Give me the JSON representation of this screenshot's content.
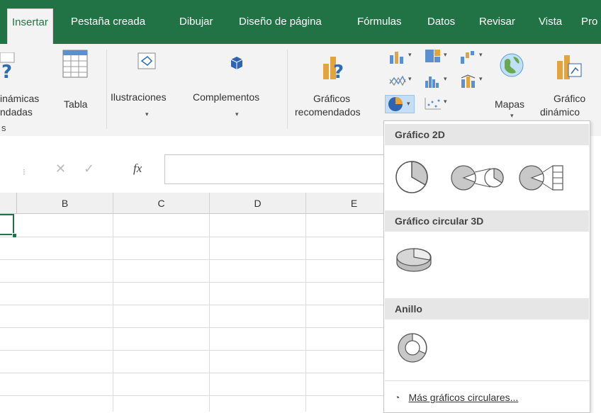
{
  "tabs": [
    {
      "label": "Insertar",
      "active": true
    },
    {
      "label": "Pestaña creada"
    },
    {
      "label": "Dibujar"
    },
    {
      "label": "Diseño de página"
    },
    {
      "label": "Fórmulas"
    },
    {
      "label": "Datos"
    },
    {
      "label": "Revisar"
    },
    {
      "label": "Vista"
    },
    {
      "label": "Pro"
    }
  ],
  "ribbon": {
    "pivot_line1": "inámicas",
    "pivot_line2": "ndadas",
    "group_label_left": "s",
    "tabla": "Tabla",
    "ilustraciones": "Ilustraciones",
    "complementos": "Complementos",
    "graficos_rec_line1": "Gráficos",
    "graficos_rec_line2": "recomendados",
    "mapas": "Mapas",
    "grafico_din_line1": "Gráfico",
    "grafico_din_line2": "dinámico"
  },
  "formula_bar": {
    "fx": "fx",
    "name_box": ""
  },
  "columns": [
    "B",
    "C",
    "D",
    "E"
  ],
  "dropdown": {
    "section_2d": "Gráfico 2D",
    "section_3d": "Gráfico circular 3D",
    "section_ring": "Anillo",
    "more_label": "Más gráficos circulares..."
  },
  "colors": {
    "excel_green": "#217346",
    "ribbon_bg": "#f3f3f3",
    "header_bg": "#e6e6e6"
  }
}
